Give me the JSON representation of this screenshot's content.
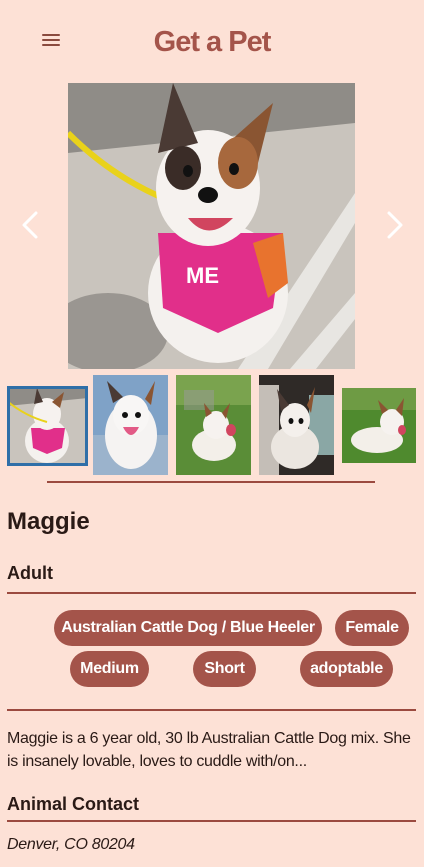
{
  "header": {
    "title": "Get a Pet",
    "menu_icon": "hamburger-menu-icon"
  },
  "gallery": {
    "prev_icon": "chevron-left-icon",
    "next_icon": "chevron-right-icon",
    "thumbnail_count": 5,
    "selected_index": 0
  },
  "pet": {
    "name": "Maggie",
    "age": "Adult",
    "tags": [
      "Australian Cattle Dog / Blue Heeler",
      "Female",
      "Medium",
      "Short",
      "adoptable"
    ],
    "description": "Maggie is a 6 year old, 30 lb Australian Cattle Dog mix. She is insanely lovable, loves to cuddle with/on..."
  },
  "contact": {
    "heading": "Animal Contact",
    "location": "Denver, CO 80204"
  },
  "colors": {
    "background": "#fde1d6",
    "accent": "#a4544a",
    "selected_outline": "#2f6fa8"
  }
}
